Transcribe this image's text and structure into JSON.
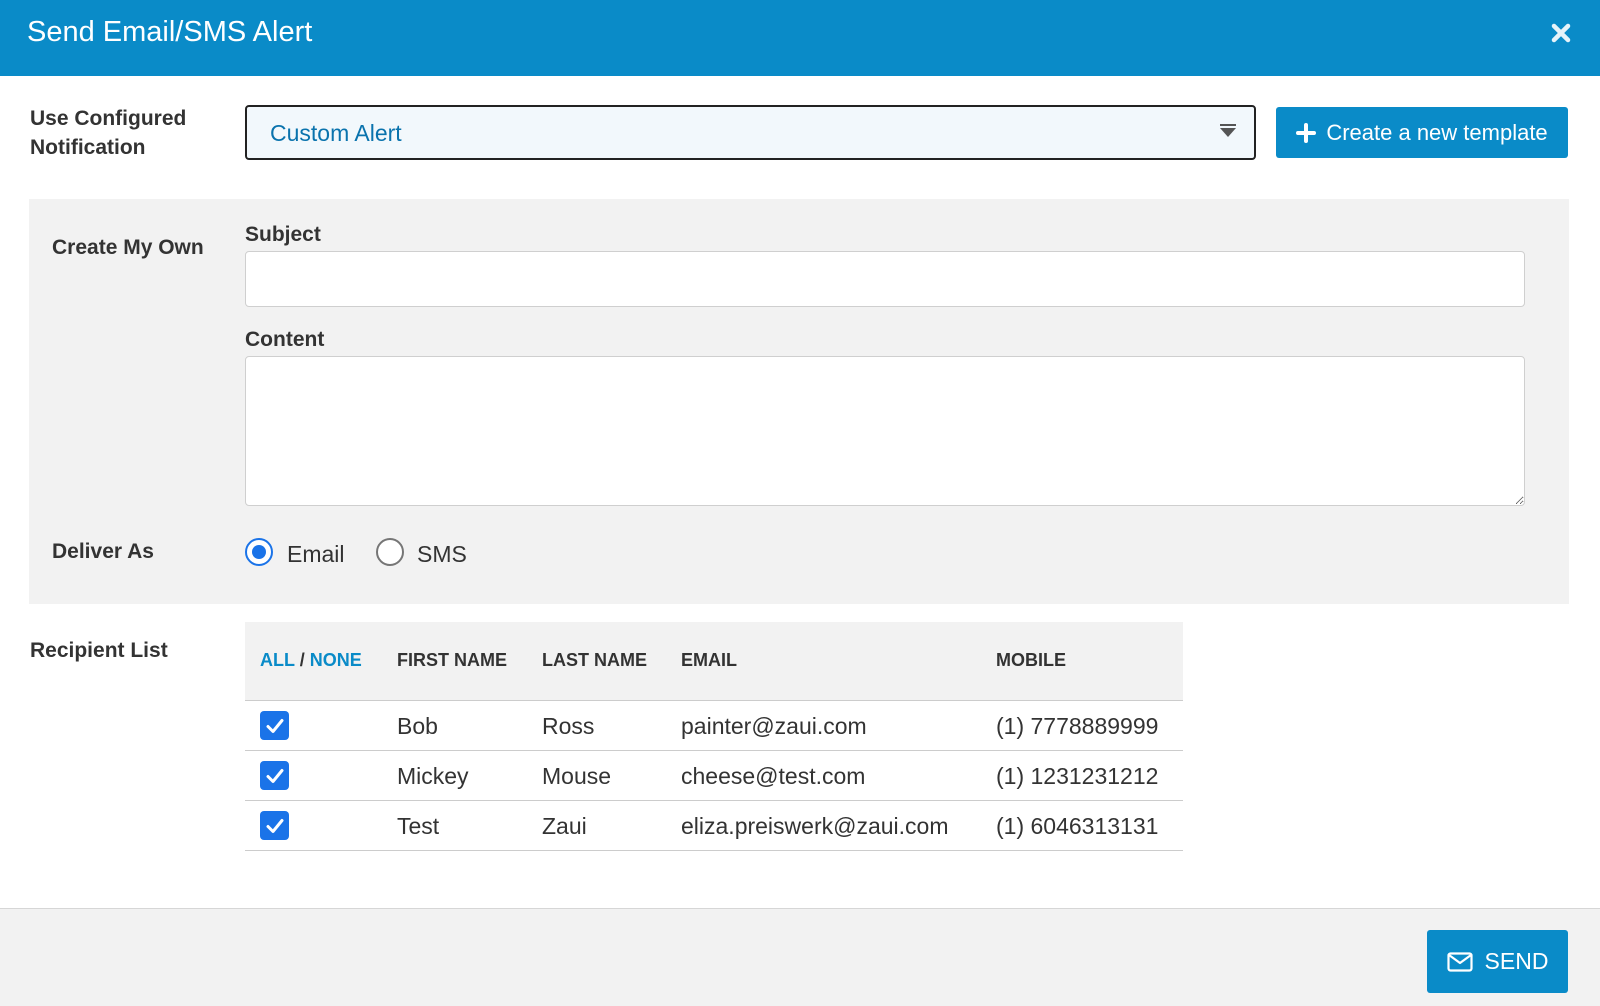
{
  "dialog": {
    "title": "Send Email/SMS Alert",
    "close_icon": "close-icon"
  },
  "notification": {
    "label_line1": "Use Configured",
    "label_line2": "Notification",
    "selected": "Custom Alert",
    "create_button_label": "Create a new template",
    "create_button_icon": "plus-icon"
  },
  "custom": {
    "section_label": "Create My Own",
    "subject_label": "Subject",
    "subject_value": "",
    "content_label": "Content",
    "content_value": ""
  },
  "deliver": {
    "label": "Deliver As",
    "options": [
      {
        "label": "Email",
        "checked": true
      },
      {
        "label": "SMS",
        "checked": false
      }
    ]
  },
  "recipients": {
    "label": "Recipient List",
    "header_all": "ALL",
    "header_sep": "/",
    "header_none": "NONE",
    "columns": [
      "FIRST NAME",
      "LAST NAME",
      "EMAIL",
      "MOBILE"
    ],
    "rows": [
      {
        "checked": true,
        "first": "Bob",
        "last": "Ross",
        "email": "painter@zaui.com",
        "mobile": "(1) 7778889999"
      },
      {
        "checked": true,
        "first": "Mickey",
        "last": "Mouse",
        "email": "cheese@test.com",
        "mobile": "(1) 1231231212"
      },
      {
        "checked": true,
        "first": "Test",
        "last": "Zaui",
        "email": "eliza.preiswerk@zaui.com",
        "mobile": "(1) 6046313131"
      }
    ]
  },
  "footer": {
    "send_label": "SEND",
    "send_icon": "envelope-icon"
  },
  "colors": {
    "brand": "#0a8bc8",
    "checkbox": "#1a73e8",
    "panel": "#f2f2f2"
  }
}
